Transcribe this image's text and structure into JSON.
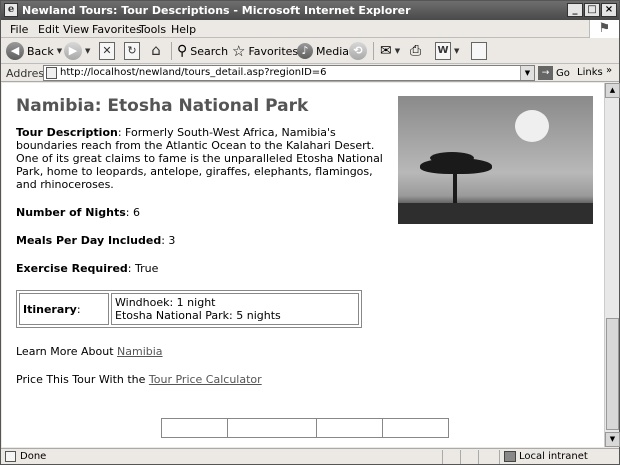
{
  "window": {
    "title": "Newland Tours: Tour Descriptions - Microsoft Internet Explorer",
    "buttons": [
      "_",
      "□",
      "×"
    ]
  },
  "menu": [
    "File",
    "Edit",
    "View",
    "Favorites",
    "Tools",
    "Help"
  ],
  "toolbar": {
    "back_label": "Back",
    "search_label": "Search",
    "favorites_label": "Favorites",
    "media_label": "Media"
  },
  "address": {
    "label": "Address",
    "url": "http://localhost/newland/tours_detail.asp?regionID=6",
    "go_label": "Go",
    "links_label": "Links"
  },
  "page": {
    "title": "Namibia: Etosha National Park",
    "description_label": "Tour Description",
    "description_text": ": Formerly South-West Africa, Namibia's boundaries reach from the Atlantic Ocean to the Kalahari Desert. One of its great claims to fame is the unparalleled Etosha National Park, home to leopards, antelope, giraffes, elephants, flamingos, and rhinoceroses.",
    "nights_label": "Number of Nights",
    "nights_value": ": 6",
    "meals_label": "Meals Per Day Included",
    "meals_value": ": 3",
    "exercise_label": "Exercise Required",
    "exercise_value": ": True",
    "itinerary_label": "Itinerary",
    "itinerary_colon": ":",
    "itinerary_items": [
      "Windhoek: 1 night",
      "Etosha National Park: 5 nights"
    ],
    "learn_more_prefix": "Learn More About ",
    "learn_more_link": "Namibia",
    "price_prefix": "Price This Tour With the ",
    "price_link": "Tour Price Calculator"
  },
  "status": {
    "text": "Done",
    "zone": "Local intranet"
  }
}
